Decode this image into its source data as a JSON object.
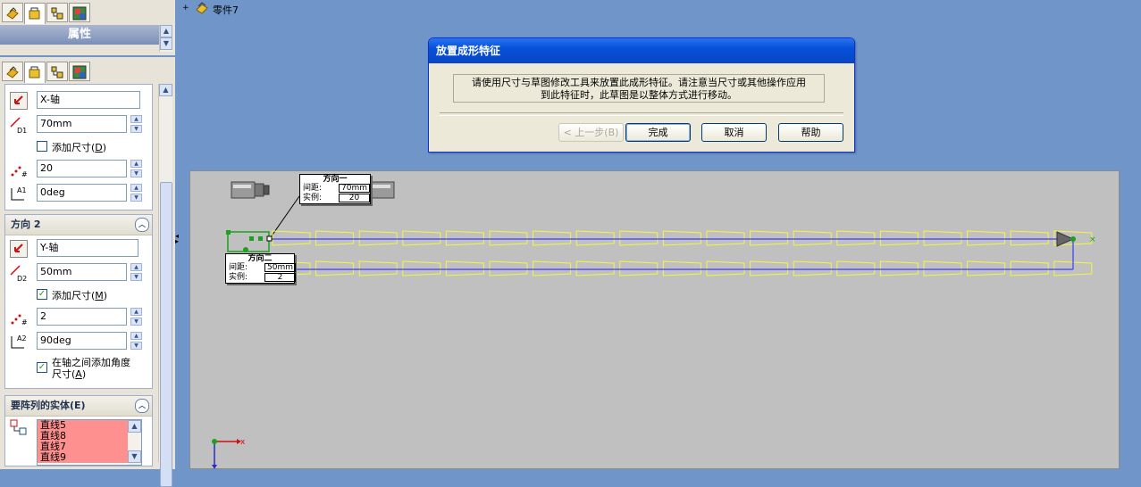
{
  "top_panel": {
    "header": "属性"
  },
  "tree": {
    "expander": "+",
    "part_label": "零件7"
  },
  "direction1": {
    "axis": "X-轴",
    "spacing": "70mm",
    "add_dim_label": "添加尺寸(",
    "add_dim_key": "D",
    "add_dim_close": ")",
    "instances": "20",
    "angle": "0deg",
    "d_icon_label": "D1",
    "a_icon_label": "A1"
  },
  "direction2": {
    "header": "方向 2",
    "axis": "Y-轴",
    "spacing": "50mm",
    "add_dim_label": "添加尺寸(",
    "add_dim_key": "M",
    "add_dim_close": ")",
    "instances": "2",
    "angle": "90deg",
    "angle_dim_label_1": "在轴之间添加角度",
    "angle_dim_label_2": "尺寸(",
    "angle_dim_key": "A",
    "angle_dim_close": ")",
    "d_icon_label": "D2",
    "a_icon_label": "A2"
  },
  "entities": {
    "header": "要阵列的实体(E)",
    "items": [
      "直线5",
      "直线8",
      "直线7",
      "直线9"
    ]
  },
  "dialog": {
    "title": "放置成形特征",
    "message_line1": "请使用尺寸与草图修改工具来放置此成形特征。请注意当尺寸或其他操作应用",
    "message_line2": "到此特征时，此草图是以整体方式进行移动。",
    "back": "< 上一步(B)",
    "finish": "完成",
    "cancel": "取消",
    "help": "帮助"
  },
  "callout1": {
    "title": "方向一",
    "spacing_label": "间距:",
    "spacing_value": "70mm",
    "instances_label": "实例:",
    "instances_value": "20"
  },
  "callout2": {
    "title": "方向二",
    "spacing_label": "间距:",
    "spacing_value": "50mm",
    "instances_label": "实例:",
    "instances_value": "2"
  },
  "triad": {
    "x_label": "x"
  },
  "colors": {
    "sketch_yellow": "#f5f542",
    "axis_blue": "#3a3aff",
    "accent_green": "#1ca11c",
    "list_highlight": "#ff9090"
  }
}
